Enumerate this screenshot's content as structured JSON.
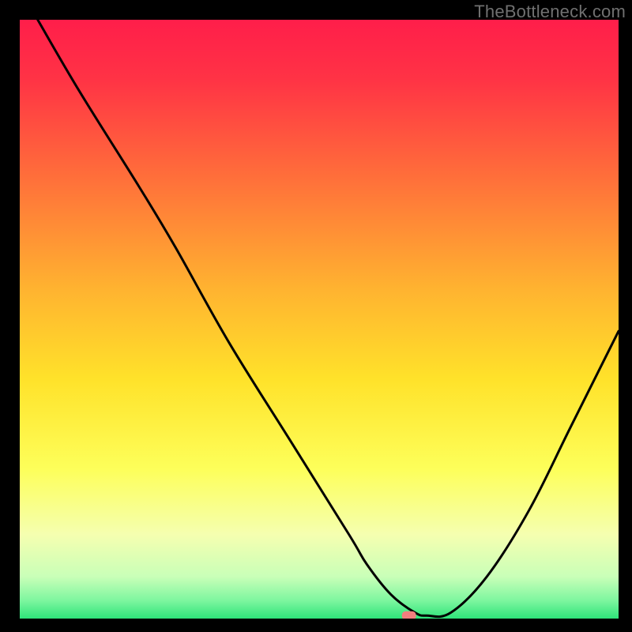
{
  "watermark": "TheBottleneck.com",
  "chart_data": {
    "type": "line",
    "title": "",
    "xlabel": "",
    "ylabel": "",
    "xlim": [
      0,
      100
    ],
    "ylim": [
      0,
      100
    ],
    "x": [
      3,
      10,
      20,
      26,
      35,
      45,
      55,
      58,
      62,
      66,
      68,
      72,
      78,
      85,
      92,
      100
    ],
    "values": [
      100,
      88,
      72,
      62,
      46,
      30,
      14,
      9,
      4,
      1,
      0.5,
      1,
      7,
      18,
      32,
      48
    ],
    "gradient_stops": [
      {
        "pos": 0.0,
        "color": "#ff1e4a"
      },
      {
        "pos": 0.1,
        "color": "#ff3345"
      },
      {
        "pos": 0.25,
        "color": "#ff6a3b"
      },
      {
        "pos": 0.45,
        "color": "#ffb330"
      },
      {
        "pos": 0.6,
        "color": "#ffe22a"
      },
      {
        "pos": 0.75,
        "color": "#fdff5a"
      },
      {
        "pos": 0.86,
        "color": "#f5ffb0"
      },
      {
        "pos": 0.93,
        "color": "#c9ffb8"
      },
      {
        "pos": 0.97,
        "color": "#7df69f"
      },
      {
        "pos": 1.0,
        "color": "#2ee47a"
      }
    ],
    "marker": {
      "x": 65,
      "y": 0.5,
      "color": "#f27e7e"
    }
  }
}
